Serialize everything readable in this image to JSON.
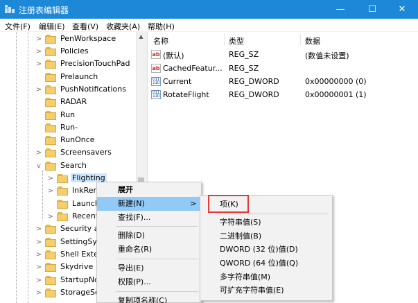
{
  "window": {
    "title": "注册表编辑器",
    "controls": {
      "minimize": "—",
      "maximize": "☐",
      "close": "✕"
    }
  },
  "menu": [
    "文件(F)",
    "编辑(E)",
    "查看(V)",
    "收藏夹(A)",
    "帮助(H)"
  ],
  "tree": {
    "items": [
      {
        "label": "PenWorkspace",
        "expander": ">"
      },
      {
        "label": "Policies",
        "expander": ">"
      },
      {
        "label": "PrecisionTouchPad",
        "expander": ">"
      },
      {
        "label": "Prelaunch",
        "expander": ""
      },
      {
        "label": "PushNotifications",
        "expander": ">"
      },
      {
        "label": "RADAR",
        "expander": ""
      },
      {
        "label": "Run",
        "expander": ""
      },
      {
        "label": "Run-",
        "expander": ""
      },
      {
        "label": "RunOnce",
        "expander": ""
      },
      {
        "label": "Screensavers",
        "expander": ">"
      },
      {
        "label": "Search",
        "expander": "v"
      },
      {
        "label": "Flighting",
        "expander": ">"
      },
      {
        "label": "InkRer",
        "expander": ">"
      },
      {
        "label": "Launch",
        "expander": ""
      },
      {
        "label": "Recent",
        "expander": ">"
      },
      {
        "label": "Security a",
        "expander": ">"
      },
      {
        "label": "SettingSyr",
        "expander": ">"
      },
      {
        "label": "Shell Exter",
        "expander": ">"
      },
      {
        "label": "Skydrive",
        "expander": ">"
      },
      {
        "label": "StartupNo",
        "expander": ">"
      },
      {
        "label": "StorageSe",
        "expander": ">"
      }
    ],
    "scroll_up": "▲"
  },
  "list": {
    "columns": {
      "name": "名称",
      "type": "类型",
      "data": "数据"
    },
    "rows": [
      {
        "icon": "string-value-icon",
        "glyph": "ab",
        "name": "(默认)",
        "type": "REG_SZ",
        "data": "(数值未设置)"
      },
      {
        "icon": "string-value-icon",
        "glyph": "ab",
        "name": "CachedFeatur...",
        "type": "REG_SZ",
        "data": ""
      },
      {
        "icon": "binary-value-icon",
        "glyph": "011 110",
        "name": "Current",
        "type": "REG_DWORD",
        "data": "0x00000000 (0)"
      },
      {
        "icon": "binary-value-icon",
        "glyph": "011 110",
        "name": "RotateFlight",
        "type": "REG_DWORD",
        "data": "0x00000001 (1)"
      }
    ]
  },
  "context_menu": {
    "items": [
      {
        "label": "展开",
        "bold": true
      },
      {
        "label": "新建(N)",
        "submenu_arrow": ">"
      },
      {
        "label": "查找(F)..."
      },
      {
        "label": "删除(D)"
      },
      {
        "label": "重命名(R)"
      },
      {
        "label": "导出(E)"
      },
      {
        "label": "权限(P)..."
      },
      {
        "label": "复制项名称(C)"
      }
    ]
  },
  "submenu": {
    "items": [
      {
        "label": "项(K)"
      },
      {
        "label": "字符串值(S)"
      },
      {
        "label": "二进制值(B)"
      },
      {
        "label": "DWORD (32 位)值(D)"
      },
      {
        "label": "QWORD (64 位)值(Q)"
      },
      {
        "label": "多字符串值(M)"
      },
      {
        "label": "可扩充字符串值(E)"
      }
    ]
  },
  "colors": {
    "titlebar": "#1e88d8",
    "selection": "#cce8ff",
    "menu_highlight": "#91c9f7",
    "annotation_box": "#e53935"
  }
}
